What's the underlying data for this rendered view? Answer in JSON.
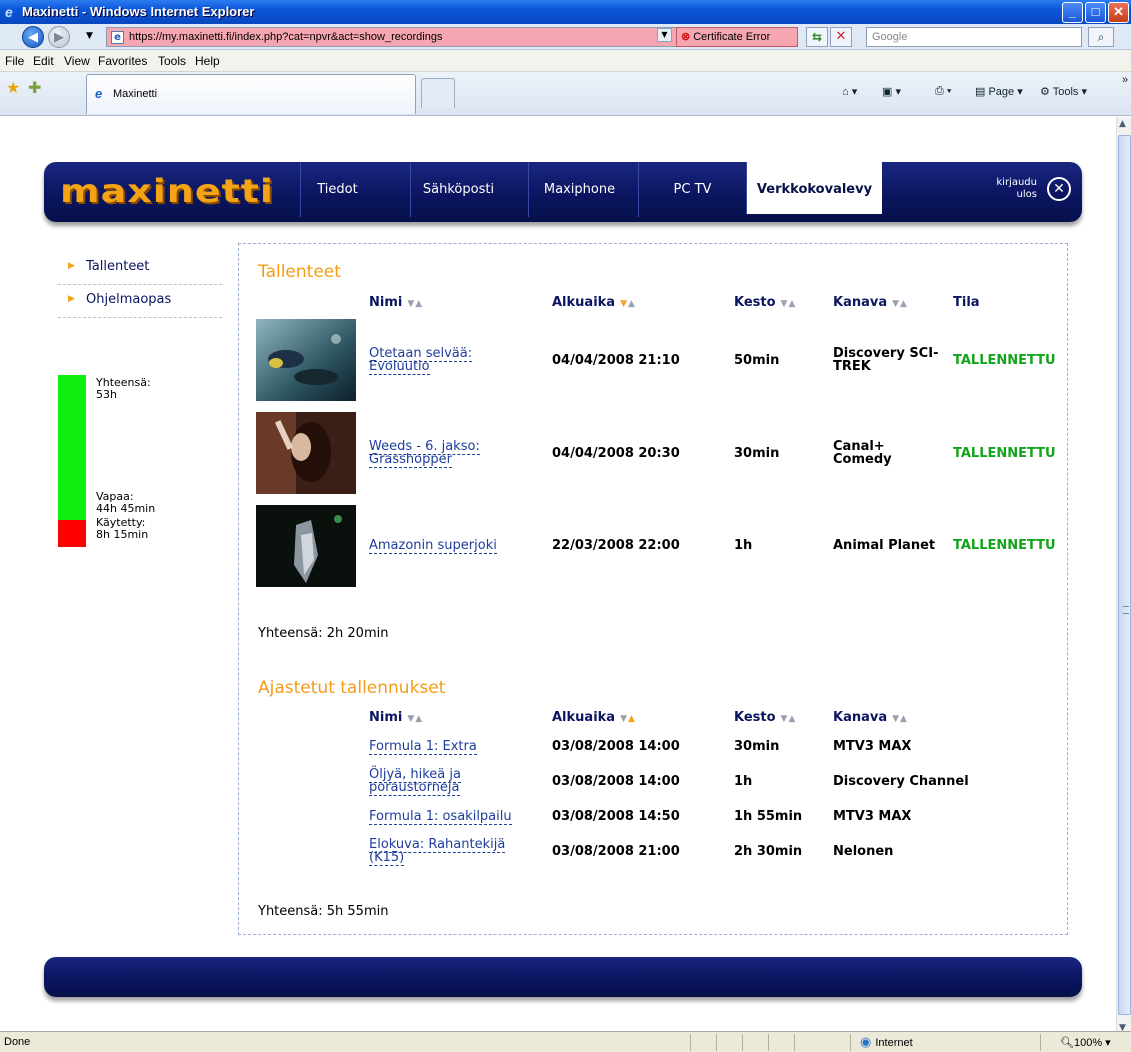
{
  "window": {
    "title": "Maxinetti - Windows Internet Explorer",
    "minimize": "_",
    "maximize": "□",
    "close": "✕"
  },
  "address": {
    "url": "https://my.maxinetti.fi/index.php?cat=npvr&act=show_recordings",
    "certificate": "Certificate Error",
    "search_placeholder": "Google"
  },
  "menu": [
    "File",
    "Edit",
    "View",
    "Favorites",
    "Tools",
    "Help"
  ],
  "tab": {
    "label": "Maxinetti"
  },
  "commands": {
    "page": "Page",
    "tools": "Tools"
  },
  "site": {
    "logo": "maxinetti",
    "nav": [
      "Tiedot",
      "Sähköposti",
      "Maxiphone",
      "PC TV",
      "Verkkokovalevy"
    ],
    "active_nav": "Verkkokovalevy",
    "logout_line1": "kirjaudu",
    "logout_line2": "ulos"
  },
  "sidebar": {
    "items": [
      "Tallenteet",
      "Ohjelmaopas"
    ]
  },
  "storage": {
    "total_label": "Yhteensä:",
    "total_value": "53h",
    "free_label": "Vapaa:",
    "free_value": "44h 45min",
    "used_label": "Käytetty:",
    "used_value": "8h 15min",
    "used_fraction": 0.156,
    "free_color": "#10ee10",
    "used_color": "#ff0000"
  },
  "recordings": {
    "title": "Tallenteet",
    "headers": {
      "name": "Nimi",
      "start": "Alkuaika",
      "duration": "Kesto",
      "channel": "Kanava",
      "status": "Tila"
    },
    "rows": [
      {
        "name_line1": "Otetaan selvää:",
        "name_line2": "Evoluutio",
        "start": "04/04/2008 21:10",
        "duration": "50min",
        "channel_line1": "Discovery SCI-",
        "channel_line2": "TREK",
        "status": "TALLENNETTU"
      },
      {
        "name_line1": "Weeds - 6. jakso:",
        "name_line2": "Grasshopper",
        "start": "04/04/2008 20:30",
        "duration": "30min",
        "channel_line1": "Canal+",
        "channel_line2": "Comedy",
        "status": "TALLENNETTU"
      },
      {
        "name_line1": "Amazonin superjoki",
        "name_line2": "",
        "start": "22/03/2008 22:00",
        "duration": "1h",
        "channel_line1": "Animal Planet",
        "channel_line2": "",
        "status": "TALLENNETTU"
      }
    ],
    "total": "Yhteensä: 2h 20min"
  },
  "scheduled": {
    "title": "Ajastetut tallennukset",
    "headers": {
      "name": "Nimi",
      "start": "Alkuaika",
      "duration": "Kesto",
      "channel": "Kanava"
    },
    "rows": [
      {
        "name_line1": "Formula 1: Extra",
        "name_line2": "",
        "start": "03/08/2008 14:00",
        "duration": "30min",
        "channel": "MTV3 MAX"
      },
      {
        "name_line1": "Öljyä, hikeä ja",
        "name_line2": "poraustorneja",
        "start": "03/08/2008 14:00",
        "duration": "1h",
        "channel": "Discovery Channel"
      },
      {
        "name_line1": "Formula 1: osakilpailu",
        "name_line2": "",
        "start": "03/08/2008 14:50",
        "duration": "1h 55min",
        "channel": "MTV3 MAX"
      },
      {
        "name_line1": "Elokuva: Rahantekijä",
        "name_line2": "(K15)",
        "start": "03/08/2008 21:00",
        "duration": "2h 30min",
        "channel": "Nelonen"
      }
    ],
    "total": "Yhteensä: 5h 55min"
  },
  "status": {
    "left": "Done",
    "zone": "Internet",
    "zoom": "100%"
  }
}
